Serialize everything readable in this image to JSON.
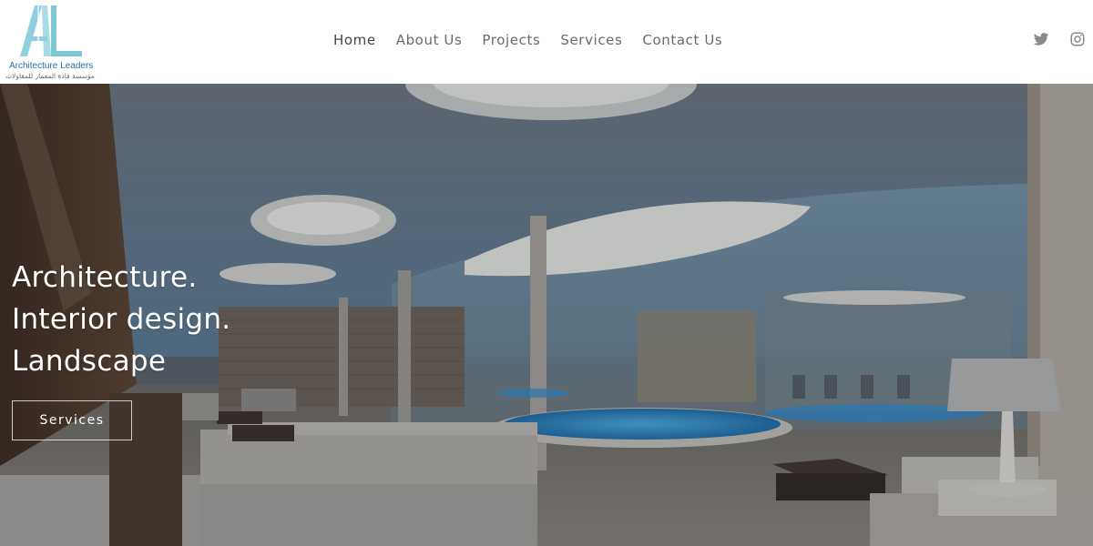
{
  "brand": {
    "name": "Architecture Leaders",
    "arabic_name": "مؤسسة قادة المعمار للمقاولات",
    "logo_icon": "al-monogram-icon",
    "logo_color": "#7cc6d6"
  },
  "nav": {
    "items": [
      {
        "label": "Home",
        "active": true
      },
      {
        "label": "About Us",
        "active": false
      },
      {
        "label": "Projects",
        "active": false
      },
      {
        "label": "Services",
        "active": false
      },
      {
        "label": "Contact Us",
        "active": false
      }
    ]
  },
  "social": {
    "icons": [
      "twitter-icon",
      "instagram-icon"
    ],
    "color": "#8a8a8a"
  },
  "hero": {
    "lines": [
      "Architecture.",
      "Interior design.",
      "Landscape"
    ],
    "button_label": "Services"
  },
  "colors": {
    "nav_text": "#6b6b6b",
    "nav_active": "#454545",
    "hero_text": "#ffffff",
    "pool": "#2f8fd4"
  }
}
